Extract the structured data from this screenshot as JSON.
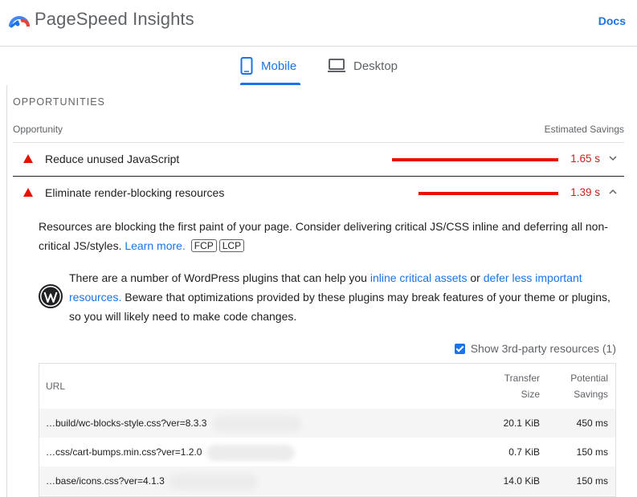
{
  "header": {
    "title": "PageSpeed Insights",
    "docs_label": "Docs"
  },
  "tabs": [
    {
      "label": "Mobile",
      "icon": "smartphone-icon",
      "selected": true
    },
    {
      "label": "Desktop",
      "icon": "monitor-icon",
      "selected": false
    }
  ],
  "opportunities": {
    "section_title": "OPPORTUNITIES",
    "col_left": "Opportunity",
    "col_right": "Estimated Savings",
    "items": [
      {
        "name": "Reduce unused JavaScript",
        "savings": "1.65 s",
        "savings_value": 1.65,
        "expanded": false
      },
      {
        "name": "Eliminate render-blocking resources",
        "savings": "1.39 s",
        "savings_value": 1.39,
        "expanded": true
      }
    ]
  },
  "details": {
    "desc_text": "Resources are blocking the first paint of your page. Consider delivering critical JS/CSS inline and deferring all non-critical JS/styles.",
    "learn_more": "Learn more.",
    "chip_fcp": "FCP",
    "chip_lcp": "LCP",
    "wp_text_1": "There are a number of WordPress plugins that can help you",
    "wp_link_1": "inline critical assets",
    "wp_or": "or",
    "wp_link_2": "defer less important resources.",
    "wp_text_2": "Beware that optimizations provided by these plugins may break features of your theme or plugins, so you will likely need to make code changes."
  },
  "third_party": {
    "label": "Show 3rd-party resources (1)",
    "checked": true
  },
  "table": {
    "headers": {
      "url": "URL",
      "transfer_1": "Transfer",
      "transfer_2": "Size",
      "savings_1": "Potential",
      "savings_2": "Savings"
    },
    "rows": [
      {
        "url": "…build/wc-blocks-style.css?ver=8.3.3",
        "size": "20.1 KiB",
        "savings": "450 ms"
      },
      {
        "url": "…css/cart-bumps.min.css?ver=1.2.0",
        "size": "0.7 KiB",
        "savings": "150 ms"
      },
      {
        "url": "…base/icons.css?ver=4.1.3",
        "size": "14.0 KiB",
        "savings": "150 ms"
      }
    ]
  },
  "colors": {
    "accent": "#1a73e8",
    "fail": "#eb0f00",
    "fail_text": "#c5221f"
  }
}
